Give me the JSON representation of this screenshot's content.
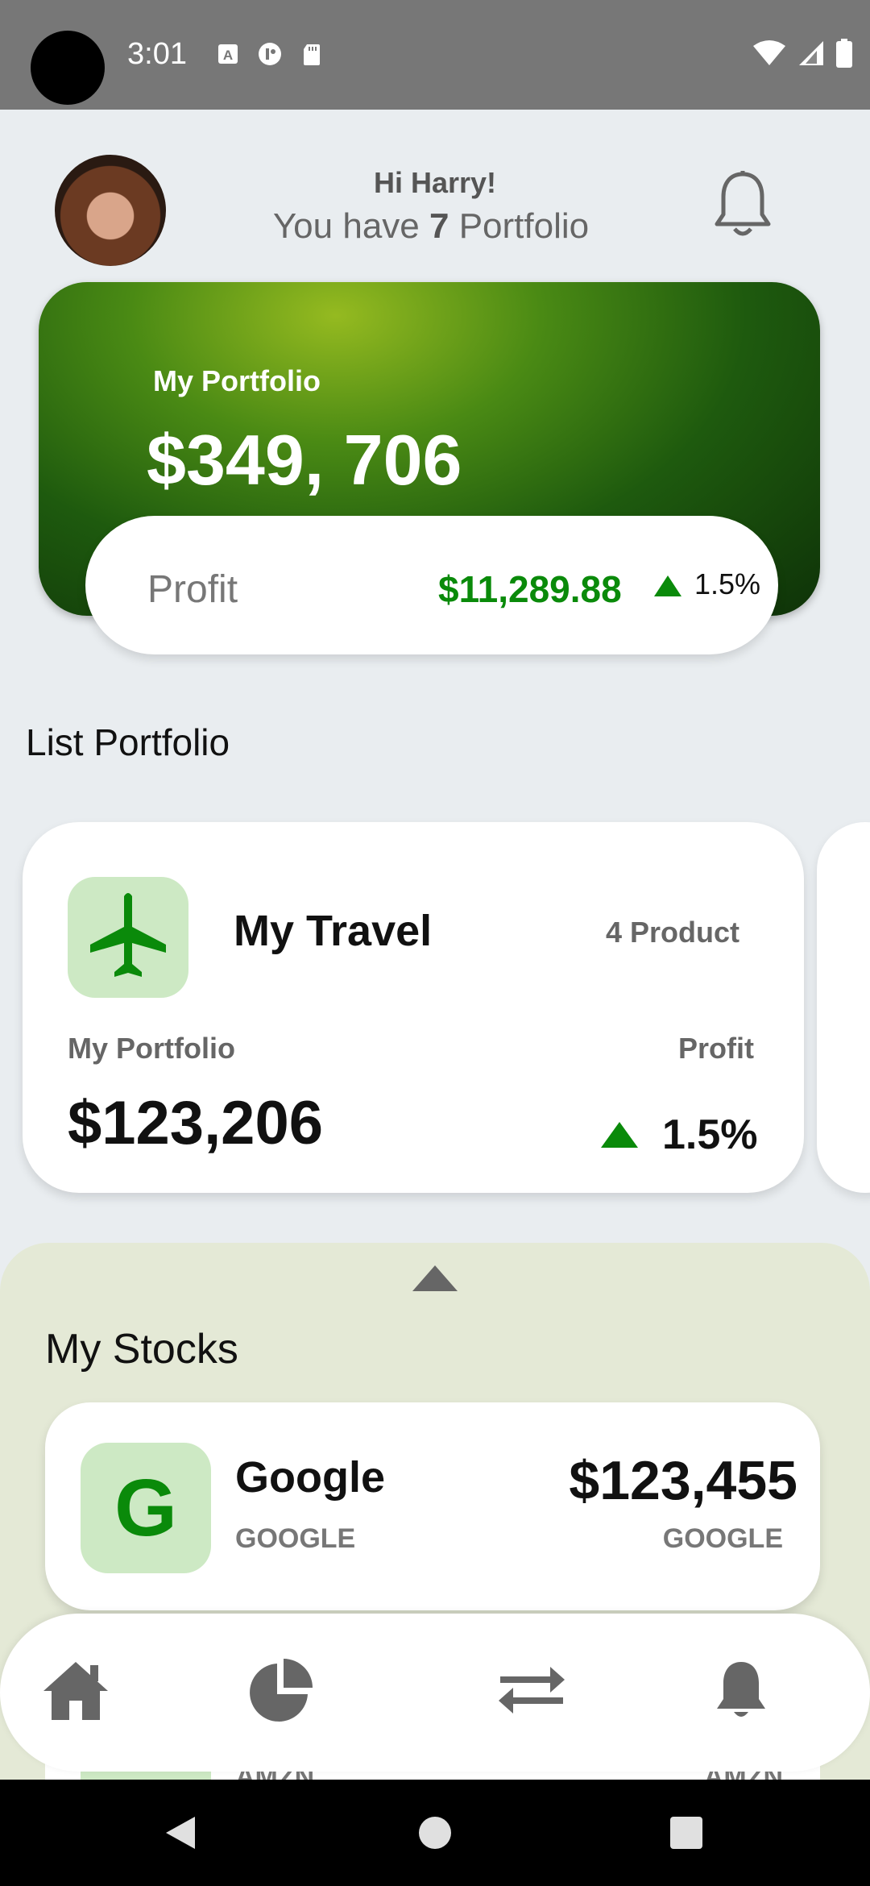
{
  "status_bar": {
    "time": "3:01",
    "left_icons": [
      "a-icon",
      "reddit-icon",
      "sdcard-icon"
    ],
    "right_icons": [
      "wifi-icon",
      "signal-icon",
      "battery-icon"
    ]
  },
  "header": {
    "greeting": "Hi Harry!",
    "subtitle_prefix": "You have ",
    "portfolio_count": "7",
    "subtitle_suffix": " Portfolio"
  },
  "portfolio_card": {
    "label": "My Portfolio",
    "value": "$349, 706",
    "profit_label": "Profit",
    "profit_amount": "$11,289.88",
    "profit_percent": "1.5%",
    "accent_color": "#0a8a0a"
  },
  "list_portfolio": {
    "title": "List Portfolio",
    "items": [
      {
        "icon": "airplane-icon",
        "title": "My Travel",
        "product_count": "4 Product",
        "portfolio_label": "My Portfolio",
        "portfolio_value": "$123,206",
        "profit_label": "Profit",
        "profit_percent": "1.5%"
      }
    ]
  },
  "stocks": {
    "title": "My Stocks",
    "items": [
      {
        "logo_letter": "G",
        "name": "Google",
        "ticker": "GOOGLE",
        "price": "$123,455",
        "ticker_right": "GOOGLE"
      },
      {
        "ticker": "AMZN",
        "ticker_right": "AMZN"
      }
    ]
  },
  "bottom_nav": {
    "items": [
      "home-icon",
      "pie-chart-icon",
      "swap-icon",
      "bell-icon"
    ]
  }
}
